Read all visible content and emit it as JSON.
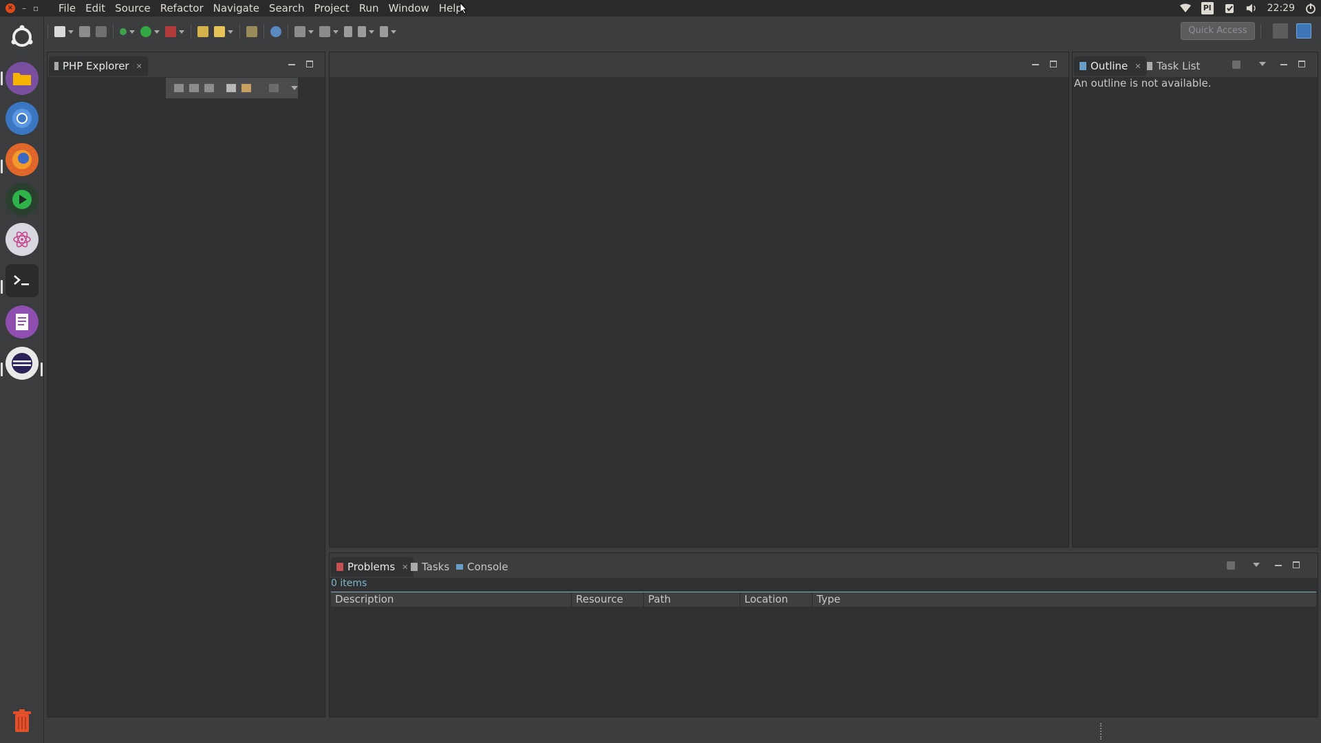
{
  "menubar": {
    "items": [
      "File",
      "Edit",
      "Source",
      "Refactor",
      "Navigate",
      "Search",
      "Project",
      "Run",
      "Window",
      "Help"
    ]
  },
  "tray": {
    "keyboard": "Pl",
    "clock": "22:29"
  },
  "toolbar": {
    "quick_access_placeholder": "Quick Access"
  },
  "php_explorer": {
    "tab_label": "PHP Explorer"
  },
  "outline": {
    "tabs": [
      "Outline",
      "Task List"
    ],
    "message": "An outline is not available."
  },
  "problems": {
    "tabs": [
      "Problems",
      "Tasks",
      "Console"
    ],
    "items_count": "0 items",
    "columns": [
      "Description",
      "Resource",
      "Path",
      "Location",
      "Type"
    ]
  },
  "colors": {
    "accent": "#7fb7c9",
    "close_button": "#df4a16"
  }
}
